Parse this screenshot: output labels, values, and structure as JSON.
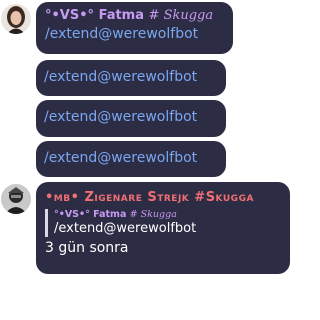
{
  "messages": [
    {
      "author_prefix": "°•VS•°",
      "author_name": "Fatma",
      "author_suffix": "# Skugga",
      "text": "/extend@werewolfbot"
    },
    {
      "text": "/extend@werewolfbot"
    },
    {
      "text": "/extend@werewolfbot"
    },
    {
      "text": "/extend@werewolfbot"
    },
    {
      "author": "•mb• Zigenare Strejk #Skugga",
      "quote": {
        "author_prefix": "°•VS•°",
        "author_name": "Fatma",
        "author_suffix": "# Skugga",
        "text": "/extend@werewolfbot"
      },
      "text": "3 gün sonra"
    }
  ],
  "colors": {
    "bubble": "#2c2c44",
    "link": "#7aa7ef",
    "fatma_name": "#c79af2",
    "zigenare_name": "#ef6f72",
    "quote_bar": "#d8d8ec"
  },
  "icons": {
    "avatar1": "woman-portrait-avatar",
    "avatar2": "dark-character-avatar"
  }
}
